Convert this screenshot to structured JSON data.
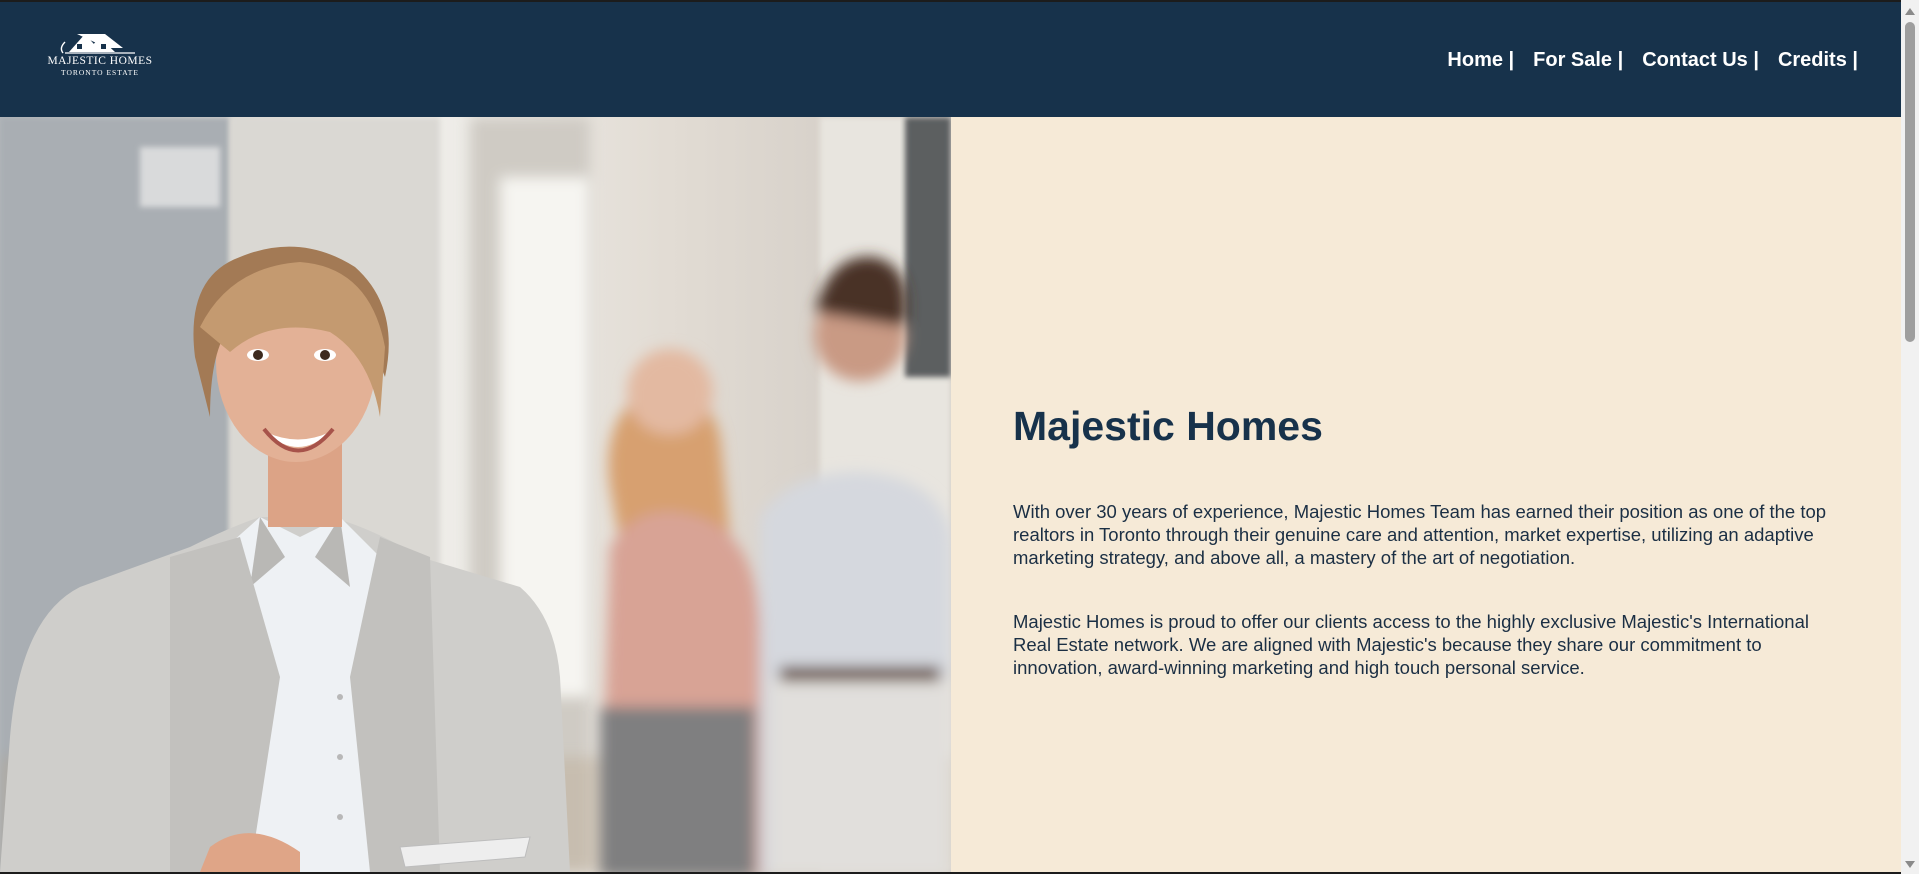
{
  "header": {
    "logo": {
      "title": "MAJESTIC HOMES",
      "subtitle": "TORONTO ESTATE"
    },
    "nav": [
      {
        "label": "Home |"
      },
      {
        "label": "For Sale |"
      },
      {
        "label": "Contact Us |"
      },
      {
        "label": "Credits |"
      }
    ]
  },
  "hero": {
    "image_alt": "Smiling realtor with couple in background"
  },
  "main": {
    "title": "Majestic Homes",
    "paragraphs": [
      "With over 30 years of experience, Majestic Homes Team has earned their position as one of the top realtors in Toronto through their genuine care and attention, market expertise, utilizing an adaptive marketing strategy, and above all, a mastery of the art of negotiation.",
      "Majestic Homes is proud to offer our clients access to the highly exclusive Majestic's International Real Estate network. We are aligned with Majestic's because they share our commitment to innovation, award-winning marketing and high touch personal service."
    ]
  },
  "colors": {
    "navy": "#17324b",
    "cream": "#f6ead7"
  }
}
